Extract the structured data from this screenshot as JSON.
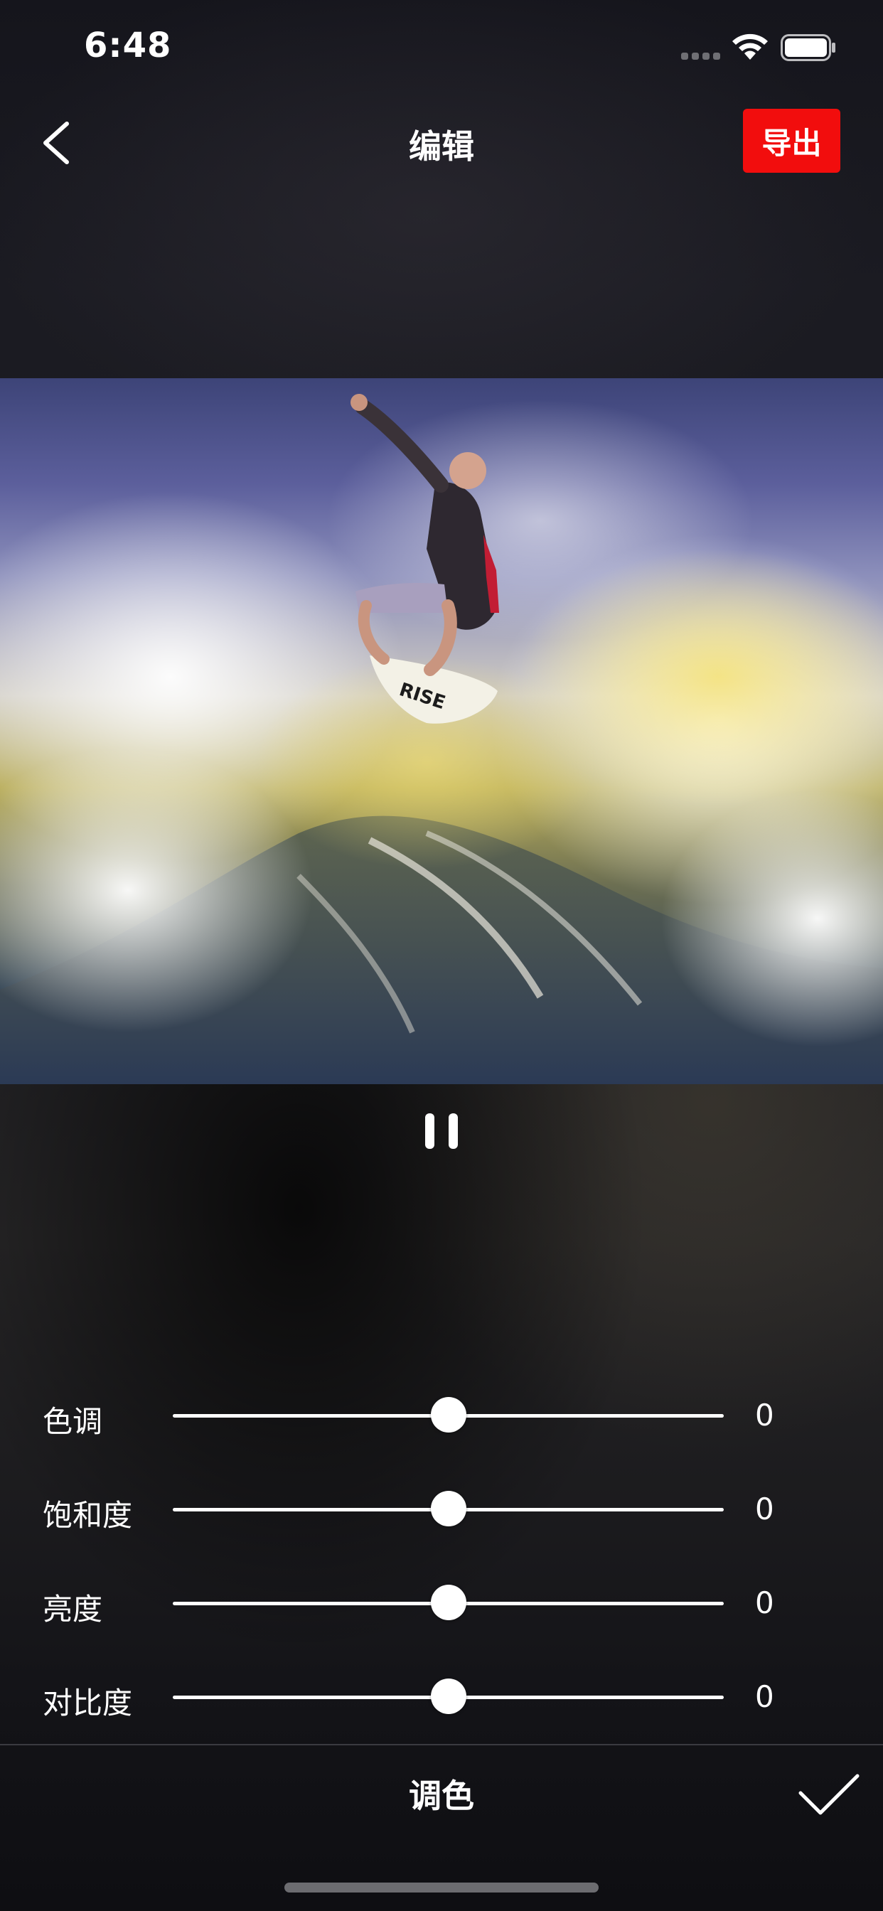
{
  "status_bar": {
    "time": "6:48",
    "icons": [
      "cellular-signal-icon",
      "wifi-icon",
      "battery-icon"
    ]
  },
  "nav": {
    "back_icon": "chevron-left-icon",
    "title": "编辑",
    "export_label": "导出",
    "export_color": "#f20d0d"
  },
  "preview": {
    "description_icon": "surfer-photo",
    "playback_icon": "pause-icon"
  },
  "adjustments": [
    {
      "label": "色调",
      "value": "0",
      "level": 0.5
    },
    {
      "label": "饱和度",
      "value": "0",
      "level": 0.5
    },
    {
      "label": "亮度",
      "value": "0",
      "level": 0.5
    },
    {
      "label": "对比度",
      "value": "0",
      "level": 0.5
    }
  ],
  "footer": {
    "title": "调色",
    "confirm_icon": "checkmark-icon"
  }
}
